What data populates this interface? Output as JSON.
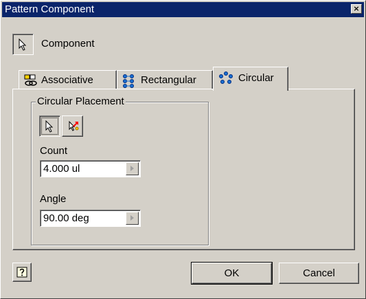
{
  "window": {
    "title": "Pattern Component",
    "close_glyph": "×"
  },
  "component": {
    "label": "Component",
    "icon": "select-arrow-icon"
  },
  "tabs": [
    {
      "label": "Associative",
      "icon": "associative-pattern-icon",
      "active": false
    },
    {
      "label": "Rectangular",
      "icon": "rectangular-pattern-icon",
      "active": false
    },
    {
      "label": "Circular",
      "icon": "circular-pattern-icon",
      "active": true
    }
  ],
  "circular": {
    "group_title": "Circular Placement",
    "select_icon": "select-arrow-icon",
    "flip_icon": "flip-direction-icon",
    "count_label": "Count",
    "count_value": "4.000 ul",
    "angle_label": "Angle",
    "angle_value": "90.00 deg"
  },
  "footer": {
    "help_icon": "help-icon",
    "ok_label": "OK",
    "cancel_label": "Cancel"
  },
  "colors": {
    "titlebar": "#0a246a",
    "face": "#d4d0c8"
  }
}
